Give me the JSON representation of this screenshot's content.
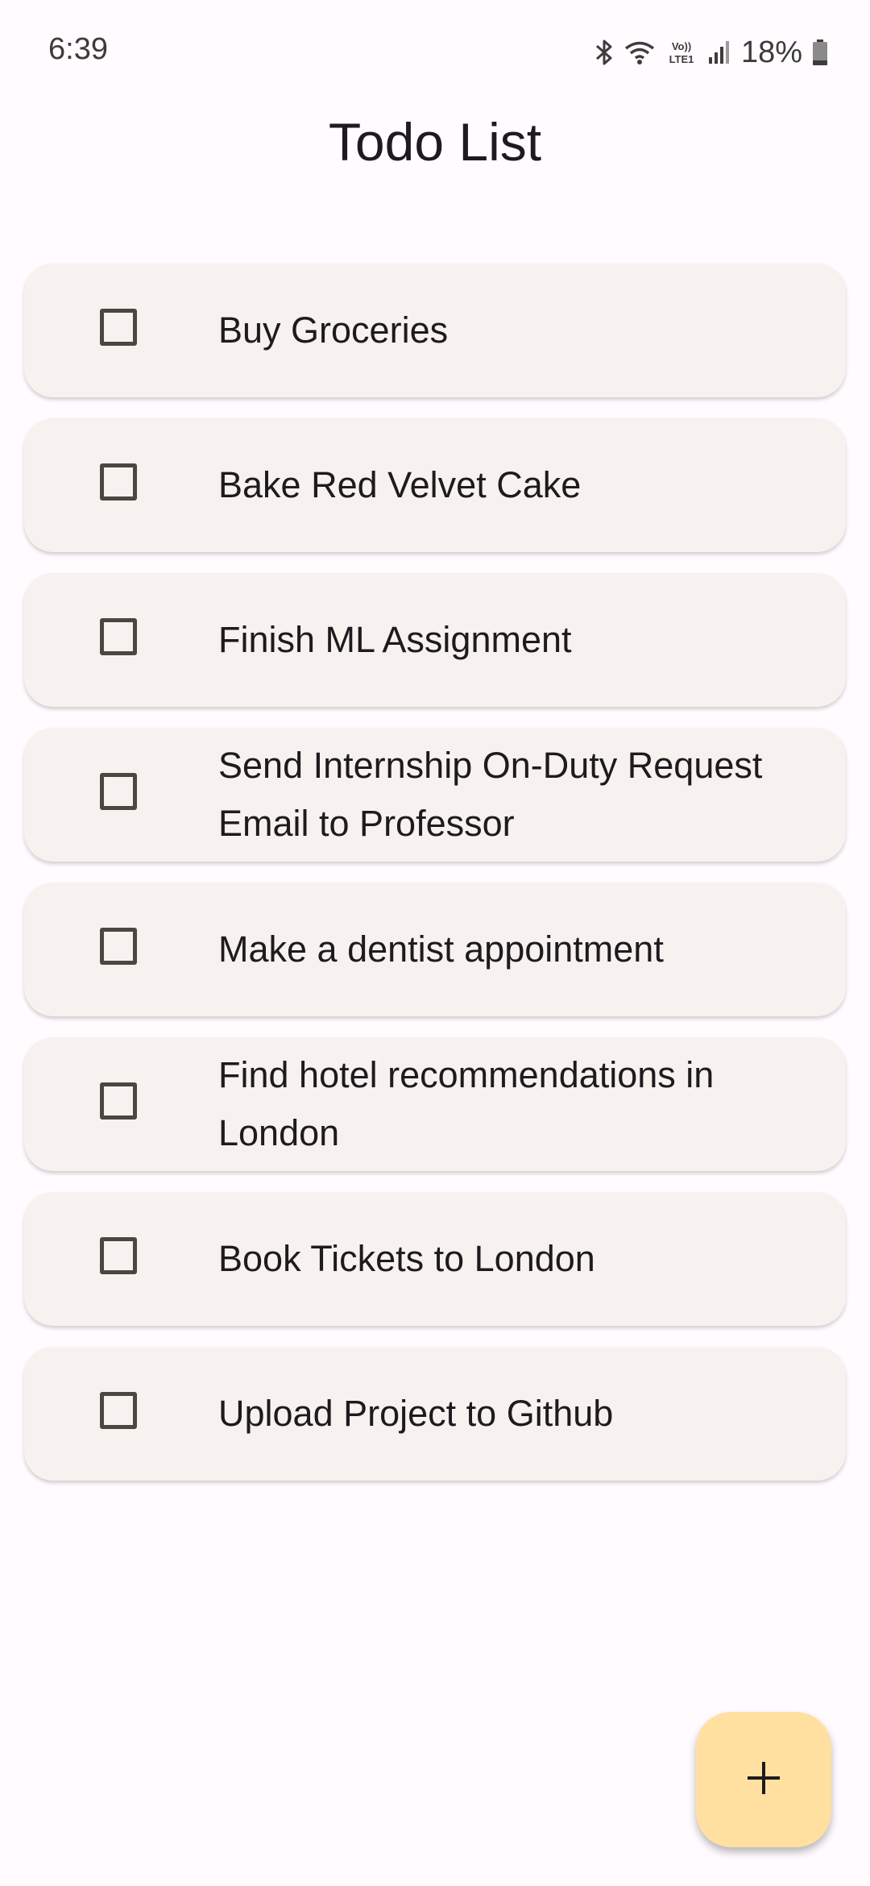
{
  "status_bar": {
    "time": "6:39",
    "network_label": "Vo)) LTE1",
    "battery_percent": "18%",
    "icons": [
      "bluetooth-icon",
      "wifi-icon",
      "volte-icon",
      "cell-signal-icon",
      "battery-icon"
    ]
  },
  "header": {
    "title": "Todo List"
  },
  "todos": [
    {
      "label": "Buy Groceries",
      "checked": false
    },
    {
      "label": "Bake Red Velvet Cake",
      "checked": false
    },
    {
      "label": "Finish ML Assignment",
      "checked": false
    },
    {
      "label": "Send Internship On-Duty Request Email to Professor",
      "checked": false
    },
    {
      "label": "Make a dentist appointment",
      "checked": false
    },
    {
      "label": "Find hotel recommendations in London",
      "checked": false
    },
    {
      "label": "Book Tickets to London",
      "checked": false
    },
    {
      "label": "Upload Project to Github",
      "checked": false
    }
  ],
  "fab": {
    "icon": "plus-icon"
  },
  "colors": {
    "background": "#fffbfe",
    "card": "#f7f2ef",
    "checkbox_border": "#4b4740",
    "fab": "#ffe0a0",
    "text": "#1d1b1e"
  }
}
